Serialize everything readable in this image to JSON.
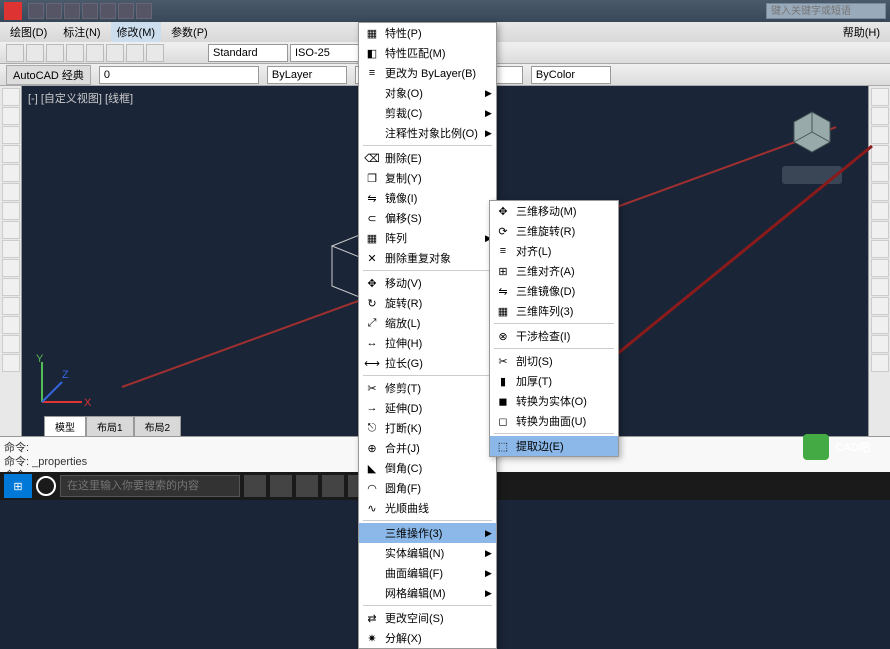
{
  "title_search_ph": "键入关键字或短语",
  "menubar": {
    "draw": "绘图(D)",
    "annot": "标注(N)",
    "modify": "修改(M)",
    "param": "参数(P)",
    "help": "帮助(H)"
  },
  "toolbar": {
    "workspace": "AutoCAD 经典",
    "layer": "0",
    "style": "Standard",
    "dim": "ISO-25"
  },
  "toolbar2": {
    "bylayer": "ByLayer",
    "bycolor": "ByColor"
  },
  "viewlabel": "[-] [自定义视图] [线框]",
  "tabs": {
    "model": "模型",
    "layout1": "布局1",
    "layout2": "布局2"
  },
  "cmd": {
    "l1": "命令:",
    "l2": "命令: _properties",
    "l3": "命令:"
  },
  "taskbar_search_ph": "在这里输入你要搜索的内容",
  "menu1": {
    "props": "特性(P)",
    "pmatch": "特性匹配(M)",
    "bylayer": "更改为 ByLayer(B)",
    "object": "对象(O)",
    "clip": "剪裁(C)",
    "annot": "注释性对象比例(O)",
    "erase": "删除(E)",
    "copy": "复制(Y)",
    "mirror": "镜像(I)",
    "offset": "偏移(S)",
    "array": "阵列",
    "deldup": "删除重复对象",
    "move": "移动(V)",
    "rotate": "旋转(R)",
    "scale": "缩放(L)",
    "stretch": "拉伸(H)",
    "lengthen": "拉长(G)",
    "trim": "修剪(T)",
    "extend": "延伸(D)",
    "break": "打断(K)",
    "join": "合并(J)",
    "chamfer": "倒角(C)",
    "fillet": "圆角(F)",
    "blend": "光顺曲线",
    "threed": "三维操作(3)",
    "solid": "实体编辑(N)",
    "surf": "曲面编辑(F)",
    "mesh": "网格编辑(M)",
    "chspace": "更改空间(S)",
    "explode": "分解(X)"
  },
  "menu2": {
    "move3d": "三维移动(M)",
    "rot3d": "三维旋转(R)",
    "align": "对齐(L)",
    "align3d": "三维对齐(A)",
    "mirror3d": "三维镜像(D)",
    "array3d": "三维阵列(3)",
    "interfere": "干涉检查(I)",
    "slice": "剖切(S)",
    "thicken": "加厚(T)",
    "tosolid": "转换为实体(O)",
    "tosurf": "转换为曲面(U)",
    "extract": "提取边(E)"
  },
  "watermark": "CAD吧"
}
